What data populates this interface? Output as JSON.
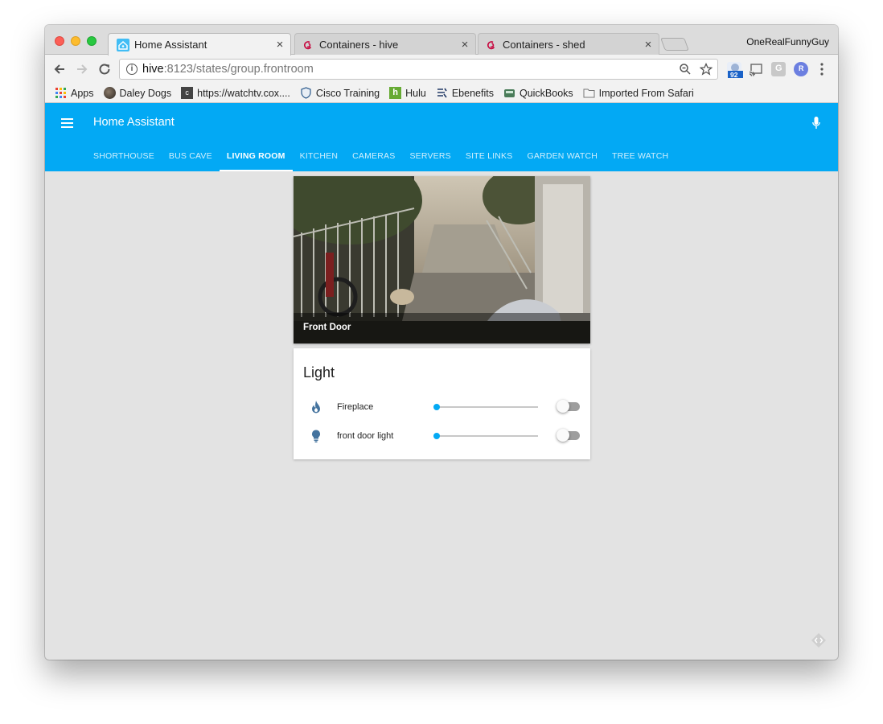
{
  "browser": {
    "tabs": [
      {
        "title": "Home Assistant",
        "active": true,
        "icon": "home-assistant-icon"
      },
      {
        "title": "Containers - hive",
        "active": false,
        "icon": "debian-swirl-icon"
      },
      {
        "title": "Containers - shed",
        "active": false,
        "icon": "debian-swirl-icon"
      }
    ],
    "close_glyph": "×",
    "profile_name": "OneRealFunnyGuy",
    "url_host": "hive",
    "url_rest": ":8123/states/group.frontroom",
    "extension_badge": "92",
    "extensions": [
      "cast-icon",
      "grammarly-icon",
      "relay-icon"
    ],
    "bookmarks": [
      {
        "label": "Apps",
        "icon": "apps-grid-icon"
      },
      {
        "label": "Daley Dogs",
        "icon": "dog-photo-icon"
      },
      {
        "label": "https://watchtv.cox....",
        "icon": "cox-icon"
      },
      {
        "label": "Cisco Training",
        "icon": "shield-icon"
      },
      {
        "label": "Hulu",
        "icon": "hulu-icon"
      },
      {
        "label": "Ebenefits",
        "icon": "ebenefits-icon"
      },
      {
        "label": "QuickBooks",
        "icon": "quickbooks-icon"
      },
      {
        "label": "Imported From Safari",
        "icon": "folder-icon"
      }
    ]
  },
  "app": {
    "title": "Home Assistant",
    "brand_color": "#03a9f4",
    "tabs": [
      {
        "label": "SHORTHOUSE",
        "active": false
      },
      {
        "label": "BUS CAVE",
        "active": false
      },
      {
        "label": "LIVING ROOM",
        "active": true
      },
      {
        "label": "KITCHEN",
        "active": false
      },
      {
        "label": "CAMERAS",
        "active": false
      },
      {
        "label": "SERVERS",
        "active": false
      },
      {
        "label": "SITE LINKS",
        "active": false
      },
      {
        "label": "GARDEN WATCH",
        "active": false
      },
      {
        "label": "TREE WATCH",
        "active": false
      }
    ]
  },
  "camera": {
    "name": "Front Door"
  },
  "light_card": {
    "title": "Light",
    "entities": [
      {
        "name": "Fireplace",
        "icon": "fire-icon",
        "brightness": 0,
        "on": false
      },
      {
        "name": "front door light",
        "icon": "lightbulb-icon",
        "brightness": 0,
        "on": false
      }
    ]
  }
}
